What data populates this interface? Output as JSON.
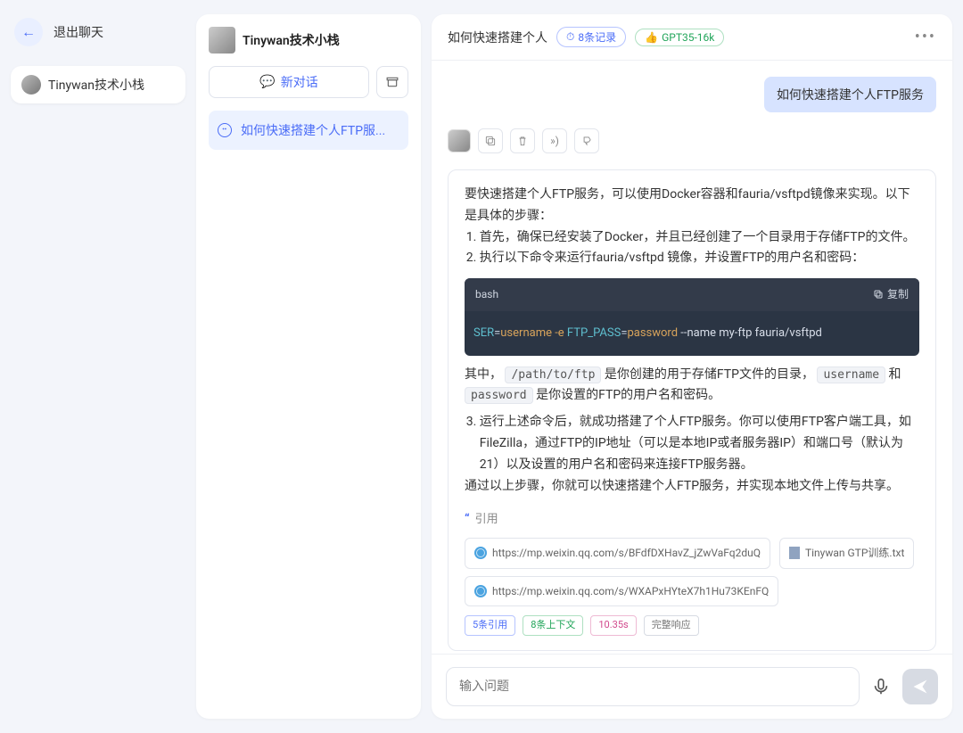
{
  "left": {
    "exit_label": "退出聊天",
    "workspace_name": "Tinywan技术小栈"
  },
  "mid": {
    "title": "Tinywan技术小栈",
    "new_chat_label": "新对话",
    "conversation_label": "如何快速搭建个人FTP服..."
  },
  "header": {
    "title": "如何快速搭建个人",
    "records_pill": "8条记录",
    "records_icon": "⏱",
    "model_pill": "GPT35-16k",
    "model_icon": "👍"
  },
  "chat": {
    "user_message": "如何快速搭建个人FTP服务",
    "answer": {
      "intro": "要快速搭建个人FTP服务，可以使用Docker容器和fauria/vsftpd镜像来实现。以下是具体的步骤：",
      "step1": "首先，确保已经安装了Docker，并且已经创建了一个目录用于存储FTP的文件。",
      "step2": "执行以下命令来运行fauria/vsftpd 镜像，并设置FTP的用户名和密码：",
      "code_lang": "bash",
      "copy_label": "复制",
      "code_tokens": {
        "a": "SER",
        "eq1": "=",
        "b": "username -e",
        "c": " FTP_PASS",
        "eq2": "=",
        "d": "password",
        "e": " --name my-ftp fauria/vsftpd"
      },
      "para2_pre": "其中，",
      "para2_c1": "/path/to/ftp",
      "para2_mid": " 是你创建的用于存储FTP文件的目录，",
      "para2_c2": "username",
      "para2_and": " 和 ",
      "para2_c3": "password",
      "para2_end": " 是你设置的FTP的用户名和密码。",
      "step3": "运行上述命令后，就成功搭建了个人FTP服务。你可以使用FTP客户端工具，如FileZilla，通过FTP的IP地址（可以是本地IP或者服务器IP）和端口号（默认为21）以及设置的用户名和密码来连接FTP服务器。",
      "conclusion": "通过以上步骤，你就可以快速搭建个人FTP服务，并实现本地文件上传与共享。",
      "ref_label": "引用",
      "refs": [
        {
          "type": "link",
          "text": "https://mp.weixin.qq.com/s/BFdfDXHavZ_jZwVaFq2duQ"
        },
        {
          "type": "file",
          "text": "Tinywan GTP训练.txt"
        },
        {
          "type": "link",
          "text": "https://mp.weixin.qq.com/s/WXAPxHYteX7h1Hu73KEnFQ"
        }
      ],
      "meta": {
        "refs_used": "5条引用",
        "context": "8条上下文",
        "latency": "10.35s",
        "status": "完整响应"
      }
    }
  },
  "footer": {
    "placeholder": "输入问题"
  }
}
